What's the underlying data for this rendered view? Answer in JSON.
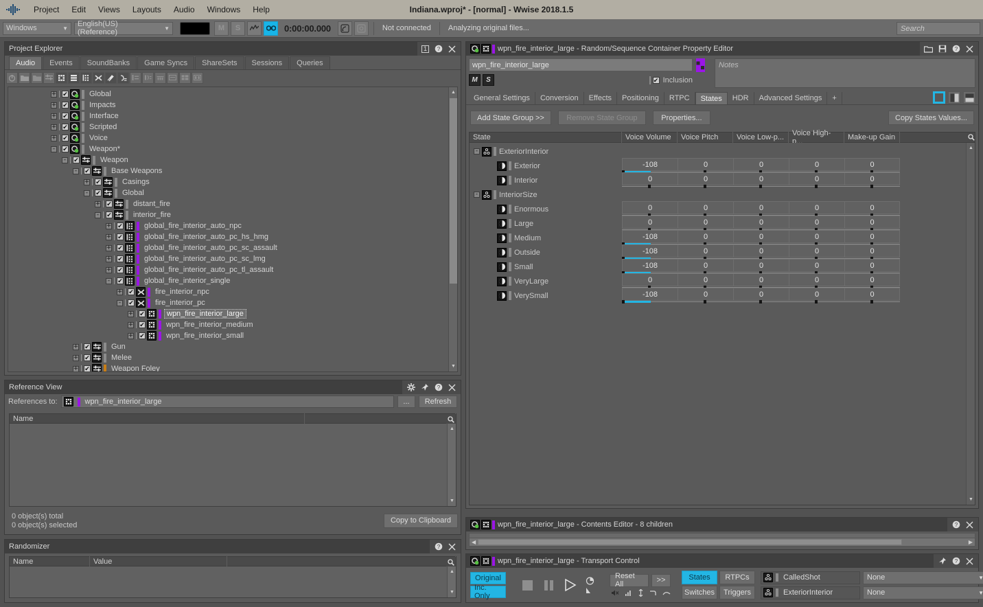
{
  "app": {
    "title": "Indiana.wproj* - [normal] - Wwise 2018.1.5",
    "menu": [
      "Project",
      "Edit",
      "Views",
      "Layouts",
      "Audio",
      "Windows",
      "Help"
    ]
  },
  "toolbar": {
    "platform": "Windows",
    "language": "English(US) (Reference)",
    "mute_label": "M",
    "solo_label": "S",
    "timecode": "0:00:00.000",
    "connection_status": "Not connected",
    "activity_status": "Analyzing original files...",
    "search_placeholder": "Search"
  },
  "project_explorer": {
    "title": "Project Explorer",
    "badge": "1",
    "tabs": [
      "Audio",
      "Events",
      "SoundBanks",
      "Game Syncs",
      "ShareSets",
      "Sessions",
      "Queries"
    ],
    "active_tab": "Audio",
    "tree": [
      {
        "label": "Global",
        "indent": 0,
        "exp": "+",
        "icon": "work-unit",
        "color": "grey"
      },
      {
        "label": "Impacts",
        "indent": 0,
        "exp": "+",
        "icon": "work-unit",
        "color": "grey"
      },
      {
        "label": "Interface",
        "indent": 0,
        "exp": "+",
        "icon": "work-unit",
        "color": "grey"
      },
      {
        "label": "Scripted",
        "indent": 0,
        "exp": "+",
        "icon": "work-unit",
        "color": "grey"
      },
      {
        "label": "Voice",
        "indent": 0,
        "exp": "+",
        "icon": "work-unit",
        "color": "grey"
      },
      {
        "label": "Weapon*",
        "indent": 0,
        "exp": "-",
        "icon": "work-unit",
        "color": "grey"
      },
      {
        "label": "Weapon",
        "indent": 1,
        "exp": "-",
        "icon": "actor-mixer",
        "color": "grey"
      },
      {
        "label": "Base Weapons",
        "indent": 2,
        "exp": "-",
        "icon": "actor-mixer",
        "color": "grey"
      },
      {
        "label": "Casings",
        "indent": 3,
        "exp": "+",
        "icon": "actor-mixer",
        "color": "grey"
      },
      {
        "label": "Global",
        "indent": 3,
        "exp": "-",
        "icon": "actor-mixer",
        "color": "grey"
      },
      {
        "label": "distant_fire",
        "indent": 4,
        "exp": "+",
        "icon": "actor-mixer",
        "color": "grey"
      },
      {
        "label": "interior_fire",
        "indent": 4,
        "exp": "-",
        "icon": "actor-mixer",
        "color": "grey"
      },
      {
        "label": "global_fire_interior_auto_npc",
        "indent": 5,
        "exp": "+",
        "icon": "blend",
        "color": "purple"
      },
      {
        "label": "global_fire_interior_auto_pc_hs_hmg",
        "indent": 5,
        "exp": "+",
        "icon": "blend",
        "color": "purple"
      },
      {
        "label": "global_fire_interior_auto_pc_sc_assault",
        "indent": 5,
        "exp": "+",
        "icon": "blend",
        "color": "purple"
      },
      {
        "label": "global_fire_interior_auto_pc_sc_lmg",
        "indent": 5,
        "exp": "+",
        "icon": "blend",
        "color": "purple"
      },
      {
        "label": "global_fire_interior_auto_pc_tl_assault",
        "indent": 5,
        "exp": "+",
        "icon": "blend",
        "color": "purple"
      },
      {
        "label": "global_fire_interior_single",
        "indent": 5,
        "exp": "-",
        "icon": "blend",
        "color": "purple"
      },
      {
        "label": "fire_interior_npc",
        "indent": 6,
        "exp": "+",
        "icon": "switch",
        "color": "purple"
      },
      {
        "label": "fire_interior_pc",
        "indent": 6,
        "exp": "-",
        "icon": "switch",
        "color": "purple"
      },
      {
        "label": "wpn_fire_interior_large",
        "indent": 7,
        "exp": "+",
        "icon": "random",
        "color": "purple",
        "selected": true
      },
      {
        "label": "wpn_fire_interior_medium",
        "indent": 7,
        "exp": "+",
        "icon": "random",
        "color": "purple"
      },
      {
        "label": "wpn_fire_interior_small",
        "indent": 7,
        "exp": "+",
        "icon": "random",
        "color": "purple"
      },
      {
        "label": "Gun",
        "indent": 2,
        "exp": "+",
        "icon": "actor-mixer",
        "color": "grey"
      },
      {
        "label": "Melee",
        "indent": 2,
        "exp": "+",
        "icon": "actor-mixer",
        "color": "grey"
      },
      {
        "label": "Weapon Foley",
        "indent": 2,
        "exp": "+",
        "icon": "actor-mixer",
        "color": "orange"
      }
    ]
  },
  "reference_view": {
    "title": "Reference View",
    "references_label": "References to:",
    "references_value": "wpn_fire_interior_large",
    "browse_label": "...",
    "refresh_label": "Refresh",
    "columns": [
      "Name",
      ""
    ],
    "rows": [],
    "total_text": "0 object(s) total",
    "selected_text": "0 object(s) selected",
    "copy_label": "Copy to Clipboard"
  },
  "randomizer": {
    "title": "Randomizer",
    "columns": [
      "Name",
      "Value",
      ""
    ],
    "rows": []
  },
  "property_editor": {
    "title": "wpn_fire_interior_large - Random/Sequence Container Property Editor",
    "object_name": "wpn_fire_interior_large",
    "mute_label": "M",
    "solo_label": "S",
    "inclusion_label": "Inclusion",
    "notes_placeholder": "Notes",
    "tabs": [
      "General Settings",
      "Conversion",
      "Effects",
      "Positioning",
      "RTPC",
      "States",
      "HDR",
      "Advanced Settings",
      "+"
    ],
    "active_tab": "States",
    "buttons": {
      "add_state_group": "Add State Group >>",
      "remove_state_group": "Remove State Group",
      "properties": "Properties...",
      "copy_states_values": "Copy States Values..."
    },
    "columns": [
      "State",
      "Voice Volume",
      "Voice Pitch",
      "Voice Low-p...",
      "Voice High-p...",
      "Make-up Gain"
    ],
    "groups": [
      {
        "name": "ExteriorInterior",
        "states": [
          {
            "name": "Exterior",
            "values": [
              "-108",
              "0",
              "0",
              "0",
              "0"
            ]
          },
          {
            "name": "Interior",
            "values": [
              "0",
              "0",
              "0",
              "0",
              "0"
            ]
          }
        ]
      },
      {
        "name": "InteriorSize",
        "states": [
          {
            "name": "Enormous",
            "values": [
              "0",
              "0",
              "0",
              "0",
              "0"
            ]
          },
          {
            "name": "Large",
            "values": [
              "0",
              "0",
              "0",
              "0",
              "0"
            ]
          },
          {
            "name": "Medium",
            "values": [
              "-108",
              "0",
              "0",
              "0",
              "0"
            ]
          },
          {
            "name": "Outside",
            "values": [
              "-108",
              "0",
              "0",
              "0",
              "0"
            ]
          },
          {
            "name": "Small",
            "values": [
              "-108",
              "0",
              "0",
              "0",
              "0"
            ]
          },
          {
            "name": "VeryLarge",
            "values": [
              "0",
              "0",
              "0",
              "0",
              "0"
            ]
          },
          {
            "name": "VerySmall",
            "values": [
              "-108",
              "0",
              "0",
              "0",
              "0"
            ]
          }
        ]
      }
    ]
  },
  "contents_editor": {
    "title": "wpn_fire_interior_large - Contents Editor  - 8 children"
  },
  "transport": {
    "title": "wpn_fire_interior_large - Transport Control",
    "original_label": "Original",
    "inc_only_label": "Inc. Only",
    "reset_all_label": "Reset All",
    "more_label": ">>",
    "toggles": [
      {
        "label": "States",
        "active": true
      },
      {
        "label": "RTPCs",
        "active": false
      },
      {
        "label": "Switches",
        "active": false
      },
      {
        "label": "Triggers",
        "active": false
      }
    ],
    "state_groups": [
      {
        "name": "CalledShot",
        "value": "None"
      },
      {
        "name": "ExteriorInterior",
        "value": "None"
      }
    ]
  },
  "colors": {
    "accent": "#23b6e4",
    "menubar": "#b2aea3",
    "purple": "#9a16e6",
    "orange": "#c87d16"
  }
}
